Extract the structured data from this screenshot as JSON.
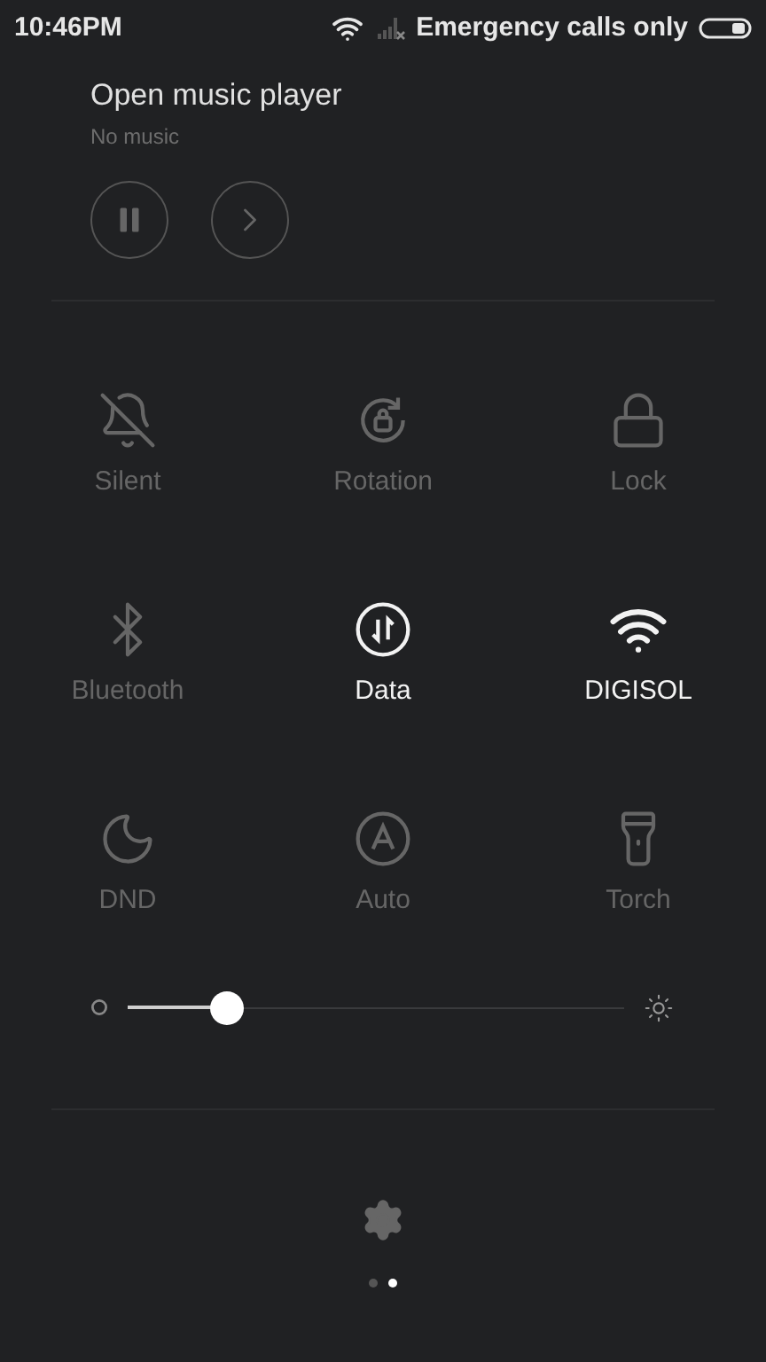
{
  "status_bar": {
    "time": "10:46PM",
    "carrier": "Emergency calls only"
  },
  "music": {
    "title": "Open music player",
    "subtitle": "No music",
    "playing": true
  },
  "toggles": [
    {
      "kind": "silent",
      "label": "Silent",
      "on": false
    },
    {
      "kind": "rotation",
      "label": "Rotation",
      "on": false
    },
    {
      "kind": "lock",
      "label": "Lock",
      "on": false
    },
    {
      "kind": "bluetooth",
      "label": "Bluetooth",
      "on": false
    },
    {
      "kind": "data",
      "label": "Data",
      "on": true
    },
    {
      "kind": "wifi",
      "label": "DIGISOL",
      "on": true
    },
    {
      "kind": "dnd",
      "label": "DND",
      "on": false
    },
    {
      "kind": "auto",
      "label": "Auto",
      "on": false
    },
    {
      "kind": "torch",
      "label": "Torch",
      "on": false
    }
  ],
  "brightness": {
    "level": 0.2
  },
  "pages": [
    {
      "selected": false
    },
    {
      "selected": true
    }
  ]
}
